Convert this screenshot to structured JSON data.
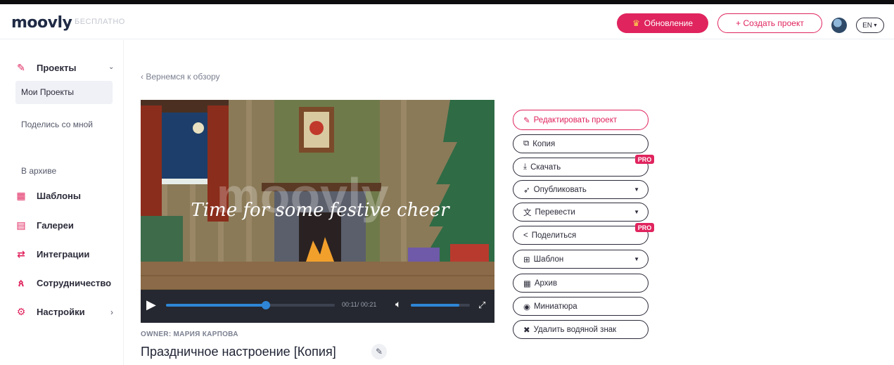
{
  "header": {
    "logo": "moovly",
    "plan": "БЕСПЛАТНО",
    "upgrade_label": "Обновление",
    "create_label": "+ Создать проект",
    "lang_label": "EN"
  },
  "sidebar": {
    "projects_label": "Проекты",
    "sub_items": [
      "Мои Проекты",
      "Поделись со мной",
      "В архиве"
    ],
    "templates_label": "Шаблоны",
    "galleries_label": "Галереи",
    "integrations_label": "Интеграции",
    "collab_label": "Сотрудничество",
    "settings_label": "Настройки"
  },
  "main": {
    "back_label": "Вернемся к обзору",
    "video_caption": "Time for some festive cheer",
    "watermark": "moovly",
    "time_label": "00:11/ 00:21",
    "progress": 0.59,
    "volume": 0.82,
    "owner_label": "OWNER: МАРИЯ КАРПОВА",
    "project_title": "Праздничное настроение [Копия]"
  },
  "actions": {
    "edit": "Редактировать проект",
    "copy": "Копия",
    "download": "Скачать",
    "publish": "Опубликовать",
    "translate": "Перевести",
    "share": "Поделиться",
    "template": "Шаблон",
    "archive": "Архив",
    "thumbnail": "Миниатюра",
    "remove_watermark": "Удалить водяной знак",
    "pro_badge": "PRO"
  },
  "colors": {
    "accent": "#e0245e",
    "text": "#2b2b3a"
  }
}
